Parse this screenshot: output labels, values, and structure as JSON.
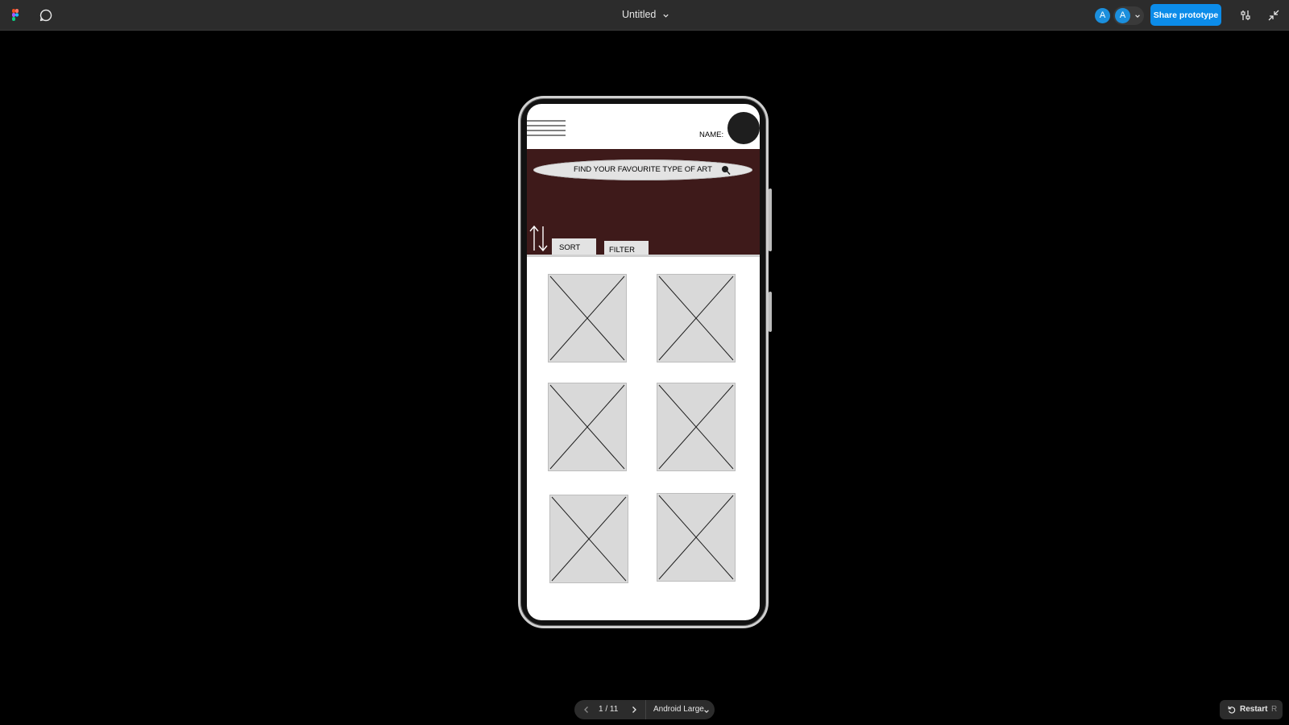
{
  "toolbar": {
    "icons": {
      "logo": "figma-logo-icon",
      "comment": "comment-bubble-icon",
      "settings": "sliders-icon",
      "collapse": "collapse-arrows-icon"
    },
    "file_title": "Untitled",
    "avatars": [
      "A",
      "A"
    ],
    "share_label": "Share prototype"
  },
  "app": {
    "name_label": "NAME:",
    "search_placeholder": "FIND YOUR FAVOURITE TYPE OF ART",
    "sort_label": "SORT",
    "filter_label": "FILTER",
    "image_placeholders": 6,
    "colors": {
      "banner": "#3e1a1a",
      "card": "#d9d9d9",
      "profile": "#1e1e1e"
    }
  },
  "footer": {
    "page_indicator": "1 / 11",
    "device_label": "Android Large",
    "restart_label": "Restart",
    "restart_shortcut": "R"
  },
  "colors": {
    "accent": "#0c8ce9",
    "toolbar_bg": "#2c2c2c",
    "canvas_bg": "#000000"
  }
}
